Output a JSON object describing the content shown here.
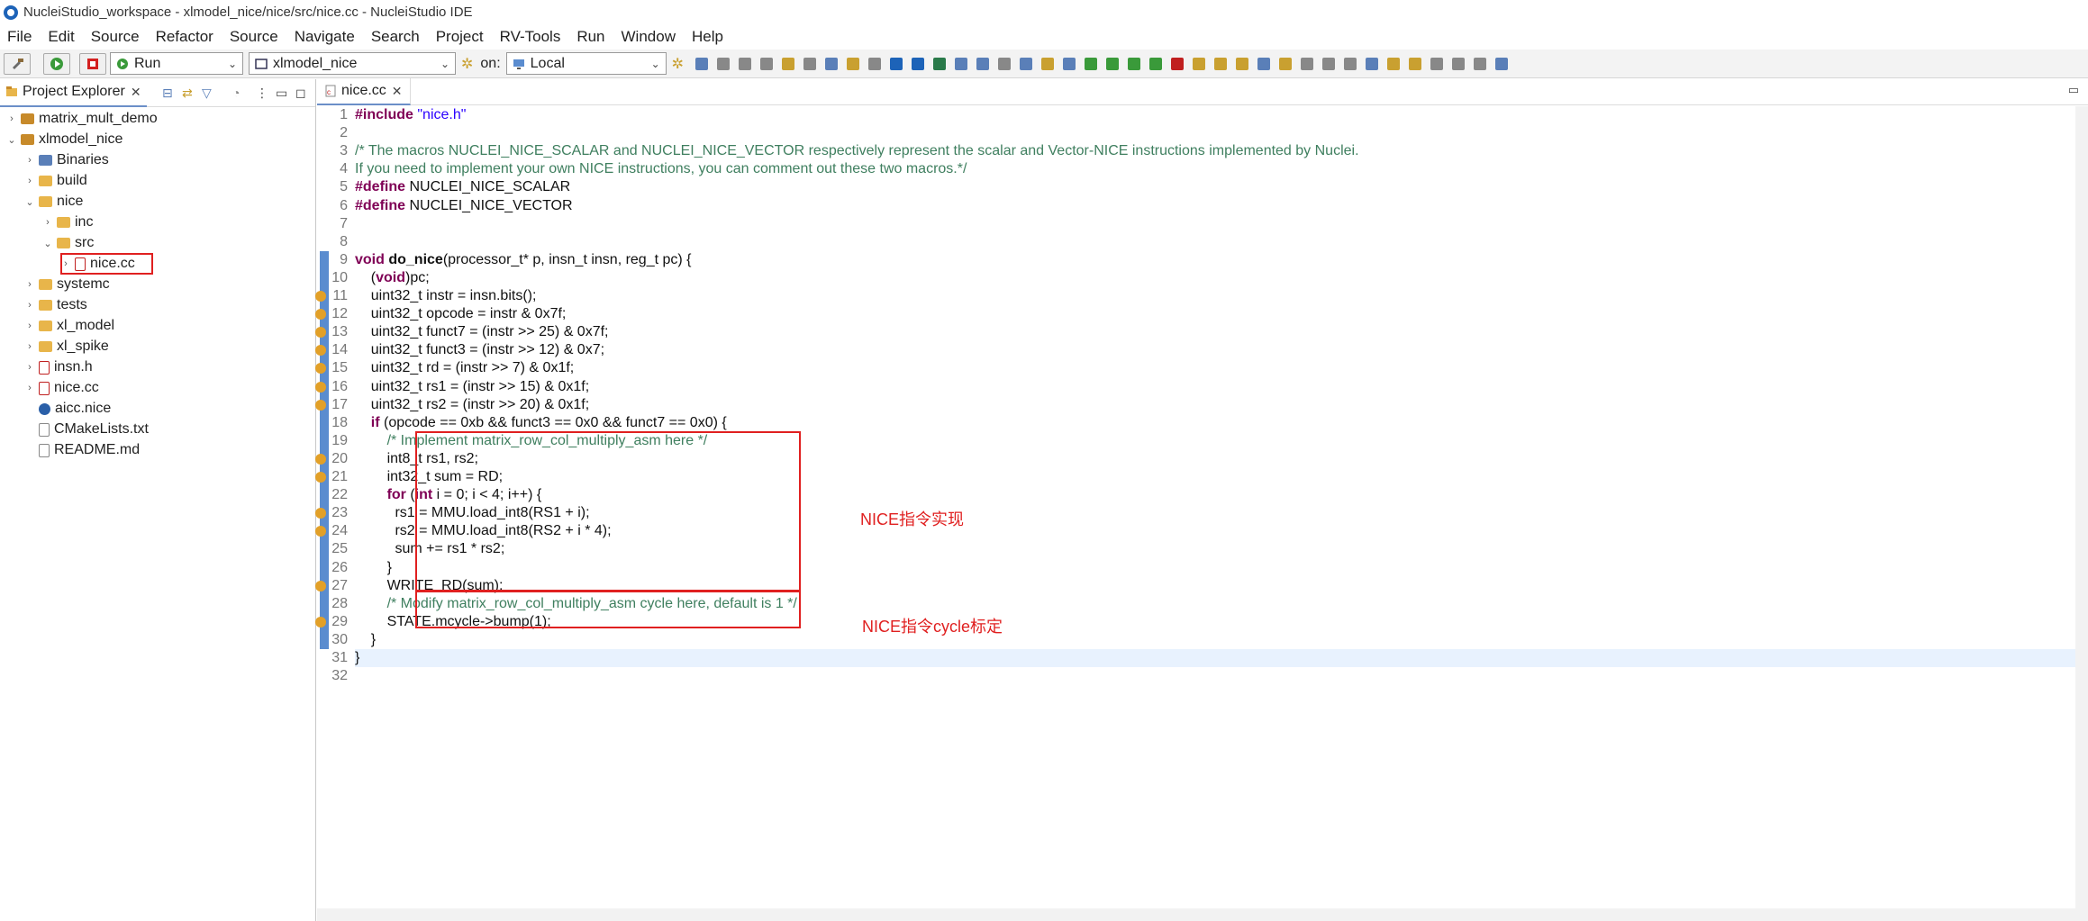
{
  "window": {
    "title": "NucleiStudio_workspace - xlmodel_nice/nice/src/nice.cc - NucleiStudio IDE"
  },
  "menu": [
    "File",
    "Edit",
    "Source",
    "Refactor",
    "Source",
    "Navigate",
    "Search",
    "Project",
    "RV-Tools",
    "Run",
    "Window",
    "Help"
  ],
  "toolbar": {
    "run_mode": "Run",
    "launch_config": "xlmodel_nice",
    "on_label": "on:",
    "target": "Local"
  },
  "project_explorer": {
    "title": "Project Explorer",
    "items": [
      {
        "label": "matrix_mult_demo",
        "depth": 0,
        "arrow": "›",
        "icon": "project-icon"
      },
      {
        "label": "xlmodel_nice",
        "depth": 0,
        "arrow": "⌄",
        "icon": "project-icon"
      },
      {
        "label": "Binaries",
        "depth": 1,
        "arrow": "›",
        "icon": "binaries-icon"
      },
      {
        "label": "build",
        "depth": 1,
        "arrow": "›",
        "icon": "folder-icon"
      },
      {
        "label": "nice",
        "depth": 1,
        "arrow": "⌄",
        "icon": "folder-icon"
      },
      {
        "label": "inc",
        "depth": 2,
        "arrow": "›",
        "icon": "folder-icon"
      },
      {
        "label": "src",
        "depth": 2,
        "arrow": "⌄",
        "icon": "folder-icon"
      },
      {
        "label": "nice.cc",
        "depth": 3,
        "arrow": "›",
        "icon": "cpp-file-icon"
      },
      {
        "label": "systemc",
        "depth": 1,
        "arrow": "›",
        "icon": "folder-icon"
      },
      {
        "label": "tests",
        "depth": 1,
        "arrow": "›",
        "icon": "folder-icon"
      },
      {
        "label": "xl_model",
        "depth": 1,
        "arrow": "›",
        "icon": "folder-icon"
      },
      {
        "label": "xl_spike",
        "depth": 1,
        "arrow": "›",
        "icon": "folder-icon"
      },
      {
        "label": "insn.h",
        "depth": 1,
        "arrow": "›",
        "icon": "header-file-icon"
      },
      {
        "label": "nice.cc",
        "depth": 1,
        "arrow": "›",
        "icon": "cpp-file-icon"
      },
      {
        "label": "aicc.nice",
        "depth": 1,
        "arrow": "",
        "icon": "gear-file-icon"
      },
      {
        "label": "CMakeLists.txt",
        "depth": 1,
        "arrow": "",
        "icon": "text-file-icon"
      },
      {
        "label": "README.md",
        "depth": 1,
        "arrow": "",
        "icon": "text-file-icon"
      }
    ]
  },
  "editor": {
    "tab": "nice.cc",
    "lines": [
      "1",
      "2",
      "3",
      "4",
      "5",
      "6",
      "7",
      "8",
      "9",
      "10",
      "11",
      "12",
      "13",
      "14",
      "15",
      "16",
      "17",
      "18",
      "19",
      "20",
      "21",
      "22",
      "23",
      "24",
      "25",
      "26",
      "27",
      "28",
      "29",
      "30",
      "31",
      "32"
    ],
    "code": [
      "#include \"nice.h\"",
      "",
      "/* The macros NUCLEI_NICE_SCALAR and NUCLEI_NICE_VECTOR respectively represent the scalar and Vector-NICE instructions implemented by Nuclei.",
      "If you need to implement your own NICE instructions, you can comment out these two macros.*/",
      "#define NUCLEI_NICE_SCALAR",
      "#define NUCLEI_NICE_VECTOR",
      "",
      "",
      "void do_nice(processor_t* p, insn_t insn, reg_t pc) {",
      "    (void)pc;",
      "    uint32_t instr = insn.bits();",
      "    uint32_t opcode = instr & 0x7f;",
      "    uint32_t funct7 = (instr >> 25) & 0x7f;",
      "    uint32_t funct3 = (instr >> 12) & 0x7;",
      "    uint32_t rd = (instr >> 7) & 0x1f;",
      "    uint32_t rs1 = (instr >> 15) & 0x1f;",
      "    uint32_t rs2 = (instr >> 20) & 0x1f;",
      "    if (opcode == 0xb && funct3 == 0x0 && funct7 == 0x0) {",
      "        /* Implement matrix_row_col_multiply_asm here */",
      "        int8_t rs1, rs2;",
      "        int32_t sum = RD;",
      "        for (int i = 0; i < 4; i++) {",
      "          rs1 = MMU.load_int8(RS1 + i);",
      "          rs2 = MMU.load_int8(RS2 + i * 4);",
      "          sum += rs1 * rs2;",
      "        }",
      "        WRITE_RD(sum);",
      "        /* Modify matrix_row_col_multiply_asm cycle here, default is 1 */",
      "        STATE.mcycle->bump(1);",
      "    }",
      "}",
      ""
    ]
  },
  "annotations": {
    "impl": "NICE指令实现",
    "cycle": "NICE指令cycle标定"
  },
  "colors": {
    "accent": "#e02020",
    "keyword": "#7f0055",
    "comment": "#3f7f5f",
    "string": "#2a00ff"
  }
}
